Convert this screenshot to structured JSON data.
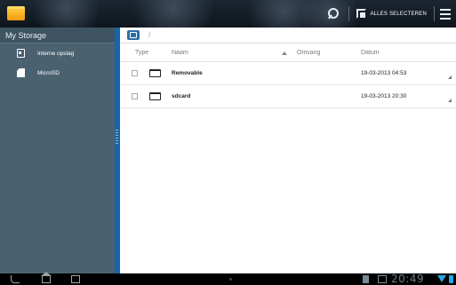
{
  "actionbar": {
    "app_icon": "folder-app-icon",
    "search_icon": "search-icon",
    "select_all_label": "ALLES SELECTEREN",
    "menu_icon": "menu-icon"
  },
  "sidebar": {
    "title": "My Storage",
    "items": [
      {
        "label": "Interne opslag",
        "icon": "internal-storage-icon"
      },
      {
        "label": "MicroSD",
        "icon": "sd-card-icon"
      }
    ]
  },
  "main": {
    "breadcrumb_sep": "/",
    "columns": {
      "type": "Type",
      "name": "Naam",
      "size": "Omvang",
      "date": "Datum"
    },
    "rows": [
      {
        "name": "Removable",
        "date": "19-03-2013 04:53"
      },
      {
        "name": "sdcard",
        "date": "19-03-2013 20:30"
      }
    ]
  },
  "navbar": {
    "clock": "20:49"
  },
  "colors": {
    "sidebar_bg": "#4a6170",
    "accent": "#1565a8",
    "status_blue": "#26a8e6"
  }
}
